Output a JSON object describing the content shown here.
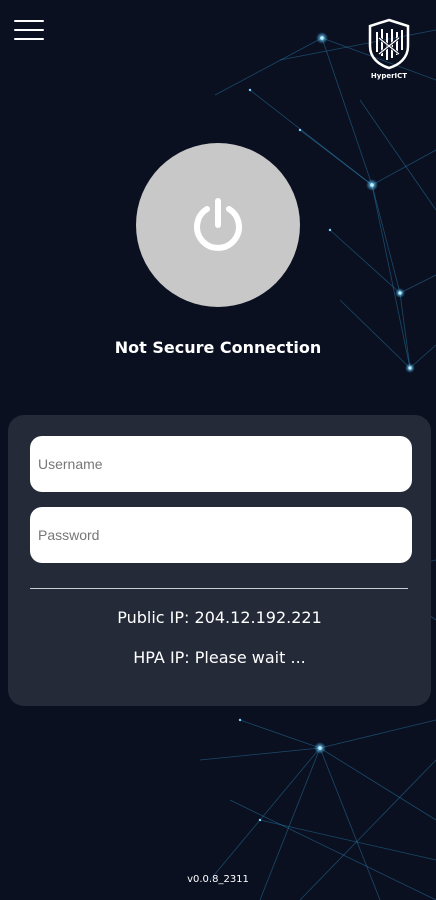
{
  "logo": {
    "name": "HyperICT"
  },
  "connection": {
    "status": "Not Secure Connection"
  },
  "login": {
    "username_placeholder": "Username",
    "username_value": "",
    "password_placeholder": "Password",
    "password_value": ""
  },
  "info": {
    "public_ip": "Public IP: 204.12.192.221",
    "hpa_ip": "HPA IP: Please wait ..."
  },
  "version": "v0.0.8_2311",
  "icons": {
    "menu": "hamburger-menu-icon",
    "power": "power-icon",
    "logo": "shield-logo-icon"
  },
  "colors": {
    "background": "#0a1020",
    "panel": "#242a37",
    "power_button": "#c8c8c8",
    "network_accent": "#3ab8ff"
  }
}
